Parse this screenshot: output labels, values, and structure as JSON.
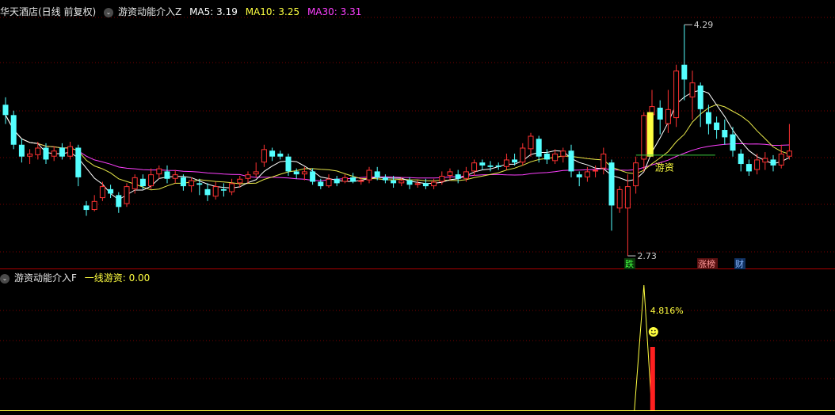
{
  "header": {
    "stock_name": "华天酒店(日线 前复权)",
    "indicator_name": "游资动能介入Z",
    "ma5_label": "MA5: 3.19",
    "ma10_label": "MA10: 3.25",
    "ma30_label": "MA30: 3.31"
  },
  "sub_header": {
    "indicator_name": "游资动能介入F",
    "value_label": "一线游资: 0.00"
  },
  "annotations": {
    "high_label": "4.29",
    "low_label": "2.73",
    "youzi_label": "游资",
    "percent_label": "4.816%",
    "tag_die": "跌",
    "tag_zhangbang": "涨榜",
    "tag_cai": "财"
  },
  "colors": {
    "up": "#ff3232",
    "down": "#54ffff",
    "ma5": "#ffffff",
    "ma10": "#e8e84a",
    "ma30": "#ff40ff",
    "grid": "#7a0000",
    "text": "#e6e6e6",
    "yellow": "#ffff40"
  },
  "chart_data": {
    "type": "candlestick",
    "price_range": [
      2.65,
      4.35
    ],
    "high": 4.29,
    "low": 2.73,
    "candles": [
      [
        3.75,
        3.68,
        3.8,
        3.62
      ],
      [
        3.68,
        3.48,
        3.71,
        3.45
      ],
      [
        3.48,
        3.4,
        3.52,
        3.36
      ],
      [
        3.4,
        3.42,
        3.45,
        3.35
      ],
      [
        3.41,
        3.46,
        3.5,
        3.38
      ],
      [
        3.46,
        3.38,
        3.49,
        3.35
      ],
      [
        3.4,
        3.44,
        3.47,
        3.37
      ],
      [
        3.46,
        3.4,
        3.49,
        3.38
      ],
      [
        3.4,
        3.47,
        3.5,
        3.38
      ],
      [
        3.46,
        3.26,
        3.48,
        3.2
      ],
      [
        3.07,
        3.04,
        3.1,
        3.0
      ],
      [
        3.04,
        3.1,
        3.14,
        3.03
      ],
      [
        3.12,
        3.2,
        3.23,
        3.1
      ],
      [
        3.18,
        3.15,
        3.21,
        3.12
      ],
      [
        3.14,
        3.06,
        3.16,
        3.02
      ],
      [
        3.08,
        3.2,
        3.22,
        3.06
      ],
      [
        3.18,
        3.26,
        3.28,
        3.15
      ],
      [
        3.25,
        3.2,
        3.28,
        3.18
      ],
      [
        3.2,
        3.28,
        3.32,
        3.18
      ],
      [
        3.28,
        3.32,
        3.34,
        3.25
      ],
      [
        3.3,
        3.25,
        3.34,
        3.22
      ],
      [
        3.25,
        3.28,
        3.31,
        3.22
      ],
      [
        3.26,
        3.2,
        3.28,
        3.17
      ],
      [
        3.2,
        3.24,
        3.26,
        3.16
      ],
      [
        3.22,
        3.21,
        3.25,
        3.14
      ],
      [
        3.18,
        3.14,
        3.22,
        3.1
      ],
      [
        3.13,
        3.2,
        3.23,
        3.11
      ],
      [
        3.18,
        3.17,
        3.22,
        3.13
      ],
      [
        3.16,
        3.22,
        3.25,
        3.14
      ],
      [
        3.22,
        3.25,
        3.27,
        3.19
      ],
      [
        3.25,
        3.28,
        3.3,
        3.22
      ],
      [
        3.28,
        3.3,
        3.36,
        3.26
      ],
      [
        3.36,
        3.45,
        3.48,
        3.33
      ],
      [
        3.44,
        3.4,
        3.46,
        3.37
      ],
      [
        3.42,
        3.4,
        3.44,
        3.38
      ],
      [
        3.4,
        3.3,
        3.42,
        3.27
      ],
      [
        3.3,
        3.28,
        3.32,
        3.25
      ],
      [
        3.28,
        3.3,
        3.33,
        3.24
      ],
      [
        3.3,
        3.23,
        3.32,
        3.21
      ],
      [
        3.23,
        3.2,
        3.25,
        3.18
      ],
      [
        3.2,
        3.25,
        3.28,
        3.19
      ],
      [
        3.25,
        3.22,
        3.27,
        3.2
      ],
      [
        3.23,
        3.26,
        3.28,
        3.22
      ],
      [
        3.26,
        3.23,
        3.29,
        3.22
      ],
      [
        3.23,
        3.24,
        3.26,
        3.21
      ],
      [
        3.24,
        3.31,
        3.33,
        3.22
      ],
      [
        3.3,
        3.26,
        3.33,
        3.24
      ],
      [
        3.26,
        3.24,
        3.28,
        3.22
      ],
      [
        3.24,
        3.22,
        3.27,
        3.19
      ],
      [
        3.22,
        3.24,
        3.26,
        3.2
      ],
      [
        3.24,
        3.21,
        3.26,
        3.18
      ],
      [
        3.21,
        3.22,
        3.24,
        3.19
      ],
      [
        3.22,
        3.2,
        3.25,
        3.18
      ],
      [
        3.2,
        3.23,
        3.25,
        3.18
      ],
      [
        3.23,
        3.27,
        3.3,
        3.21
      ],
      [
        3.27,
        3.3,
        3.32,
        3.24
      ],
      [
        3.28,
        3.25,
        3.31,
        3.22
      ],
      [
        3.25,
        3.3,
        3.33,
        3.23
      ],
      [
        3.3,
        3.36,
        3.38,
        3.27
      ],
      [
        3.36,
        3.34,
        3.38,
        3.31
      ],
      [
        3.34,
        3.33,
        3.37,
        3.3
      ],
      [
        3.34,
        3.33,
        3.36,
        3.31
      ],
      [
        3.33,
        3.38,
        3.42,
        3.31
      ],
      [
        3.38,
        3.36,
        3.42,
        3.34
      ],
      [
        3.36,
        3.46,
        3.49,
        3.34
      ],
      [
        3.45,
        3.54,
        3.56,
        3.4
      ],
      [
        3.52,
        3.4,
        3.54,
        3.36
      ],
      [
        3.42,
        3.38,
        3.45,
        3.35
      ],
      [
        3.37,
        3.42,
        3.45,
        3.35
      ],
      [
        3.4,
        3.44,
        3.46,
        3.36
      ],
      [
        3.44,
        3.3,
        3.48,
        3.26
      ],
      [
        3.28,
        3.26,
        3.3,
        3.2
      ],
      [
        3.26,
        3.3,
        3.33,
        3.23
      ],
      [
        3.3,
        3.31,
        3.34,
        3.26
      ],
      [
        3.32,
        3.42,
        3.46,
        3.28
      ],
      [
        3.36,
        3.07,
        3.38,
        2.9
      ],
      [
        3.05,
        3.18,
        3.2,
        3.02
      ],
      [
        3.05,
        3.2,
        3.28,
        2.73
      ],
      [
        3.2,
        3.36,
        3.4,
        3.15
      ],
      [
        3.38,
        3.68,
        3.7,
        3.3
      ],
      [
        3.68,
        3.74,
        3.85,
        3.6
      ],
      [
        3.73,
        3.65,
        3.78,
        3.55
      ],
      [
        3.62,
        3.72,
        3.85,
        3.56
      ],
      [
        3.66,
        3.98,
        4.02,
        3.6
      ],
      [
        4.02,
        3.92,
        4.29,
        3.78
      ],
      [
        3.8,
        3.9,
        3.98,
        3.65
      ],
      [
        3.88,
        3.72,
        3.9,
        3.6
      ],
      [
        3.7,
        3.62,
        3.75,
        3.55
      ],
      [
        3.63,
        3.58,
        3.67,
        3.52
      ],
      [
        3.58,
        3.53,
        3.65,
        3.48
      ],
      [
        3.55,
        3.44,
        3.6,
        3.4
      ],
      [
        3.42,
        3.35,
        3.45,
        3.3
      ],
      [
        3.35,
        3.3,
        3.38,
        3.27
      ],
      [
        3.31,
        3.38,
        3.42,
        3.28
      ],
      [
        3.36,
        3.39,
        3.43,
        3.31
      ],
      [
        3.38,
        3.34,
        3.41,
        3.3
      ],
      [
        3.34,
        3.42,
        3.48,
        3.32
      ],
      [
        3.4,
        3.44,
        3.62,
        3.38
      ]
    ],
    "youzi_signal": [
      {
        "date_index": 79,
        "value": 4.816
      }
    ]
  }
}
